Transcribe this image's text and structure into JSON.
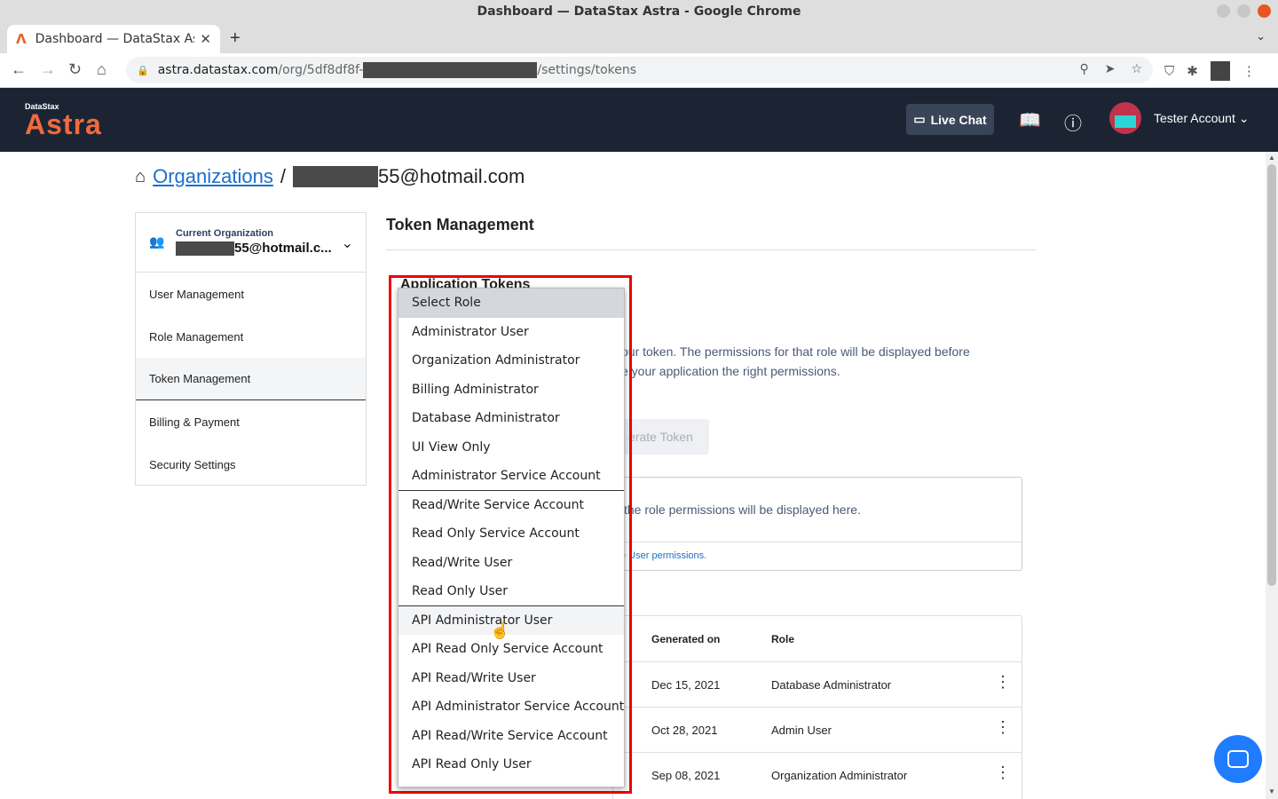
{
  "browser": {
    "window_title": "Dashboard — DataStax Astra - Google Chrome",
    "tab_title": "Dashboard — DataStax As",
    "url_host": "astra.datastax.com",
    "url_path_start": "/org/5df8df8f-",
    "url_path_end": "/settings/tokens"
  },
  "header": {
    "logo_small": "DataStax",
    "logo_big": "Astra",
    "live_chat": "Live Chat",
    "account_name": "Tester Account"
  },
  "breadcrumb": {
    "root": "Organizations",
    "separator": "/",
    "current_suffix": "55@hotmail.com"
  },
  "sidebar": {
    "org_label": "Current Organization",
    "org_name_suffix": "55@hotmail.c...",
    "items": [
      {
        "label": "User Management"
      },
      {
        "label": "Role Management"
      },
      {
        "label": "Token Management"
      },
      {
        "label": "Billing & Payment"
      },
      {
        "label": "Security Settings"
      }
    ]
  },
  "content": {
    "title": "Token Management",
    "section_title": "Application Tokens",
    "desc_line1": "our token. The permissions for that role will be displayed before",
    "desc_line2": "e your application the right permissions.",
    "generate_button": "erate Token",
    "perm_text": "the role permissions will be displayed here.",
    "perm_link": "e User permissions."
  },
  "table": {
    "headers": {
      "generated": "Generated on",
      "role": "Role"
    },
    "rows": [
      {
        "generated": "Dec 15, 2021",
        "role": "Database Administrator"
      },
      {
        "generated": "Oct 28, 2021",
        "role": "Admin User"
      },
      {
        "generated": "Sep 08, 2021",
        "role": "Organization Administrator"
      }
    ]
  },
  "dropdown": {
    "options": [
      "Select Role",
      "Administrator User",
      "Organization Administrator",
      "Billing Administrator",
      "Database Administrator",
      "UI View Only",
      "Administrator Service Account",
      "Read/Write Service Account",
      "Read Only Service Account",
      "Read/Write User",
      "Read Only User",
      "API Administrator User",
      "API Read Only Service Account",
      "API Read/Write User",
      "API Administrator Service Account",
      "API Read/Write Service Account",
      "API Read Only User"
    ],
    "selected": "Select Role",
    "hovered": "API Administrator User"
  }
}
